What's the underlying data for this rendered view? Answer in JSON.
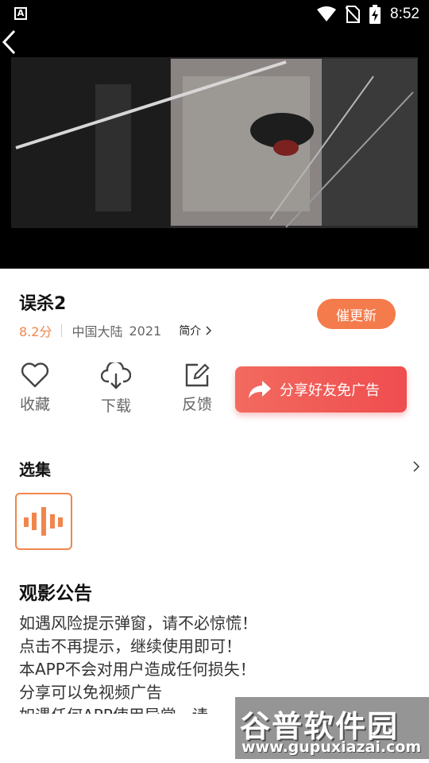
{
  "status_bar": {
    "time": "8:52"
  },
  "movie": {
    "title": "误杀2",
    "score": "8.2分",
    "region": "中国大陆",
    "year": "2021",
    "intro_label": "简介",
    "update_button": "催更新"
  },
  "actions": [
    {
      "label": "收藏",
      "icon": "heart-icon"
    },
    {
      "label": "下载",
      "icon": "cloud-download-icon"
    },
    {
      "label": "反馈",
      "icon": "edit-icon"
    }
  ],
  "share_button": {
    "label": "分享好友免广告",
    "icon": "share-arrow-icon"
  },
  "episodes_section": {
    "title": "选集"
  },
  "notice": {
    "title": "观影公告",
    "lines": [
      "如遇风险提示弹窗，请不必惊慌！",
      "点击不再提示，继续使用即可！",
      "本APP不会对用户造成任何损失！",
      "分享可以免视频广告",
      "如遇任何APP使用异常，请"
    ]
  },
  "watermark": {
    "brand": "谷普软件园",
    "url": "www.gupuxiazai.com"
  },
  "colors": {
    "accent": "#f1864c",
    "share_red": "#ef4d4f"
  }
}
